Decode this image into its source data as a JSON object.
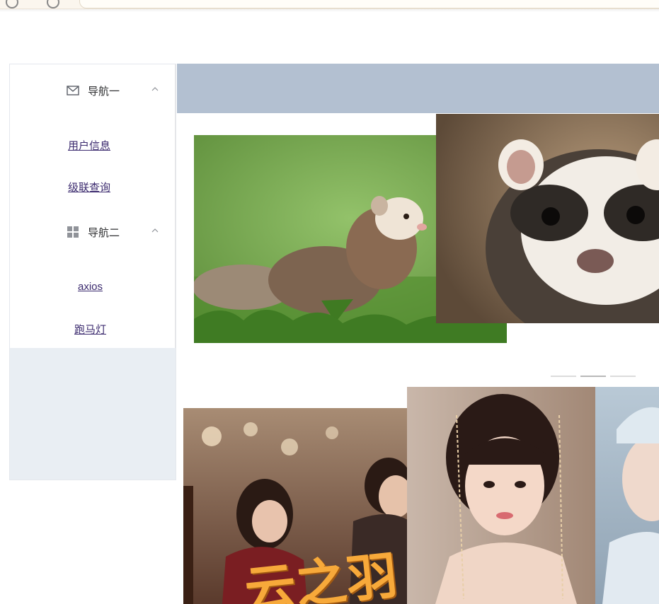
{
  "sidebar": {
    "nav1": {
      "label": "导航一",
      "icon": "envelope-icon"
    },
    "nav1_items": [
      {
        "label": "用户信息"
      },
      {
        "label": "级联查询"
      }
    ],
    "nav2": {
      "label": "导航二",
      "icon": "grid-icon"
    },
    "nav2_items": [
      {
        "label": "axios"
      },
      {
        "label": "跑马灯"
      }
    ]
  },
  "header": {
    "color": "#b3c0d1"
  },
  "carousel_top": {
    "indicators": 3,
    "active_index": 1,
    "images": [
      "ferret-in-grass-photo",
      "ferret-closeup-photo"
    ]
  },
  "carousel_bottom": {
    "images": [
      "drama-poster-photo",
      "actress-portrait-photo",
      "actor-portrait-photo"
    ],
    "poster_text": "云之羽"
  },
  "colors": {
    "sidebar_bg": "#e9eef3",
    "link": "#3b2a6e",
    "header": "#b3c0d1"
  }
}
